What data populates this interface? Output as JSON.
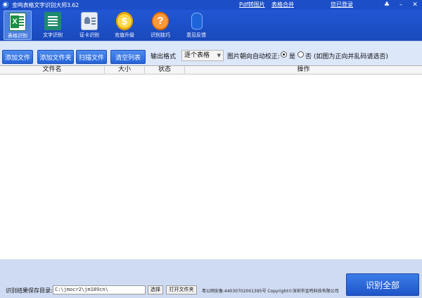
{
  "titlebar": {
    "title": "金鸣表格文字识别大师3.62",
    "links": {
      "pdf": "Pdf转图片",
      "merge": "表格合并",
      "login": "您已登录"
    },
    "window_buttons": {
      "skin": "♣",
      "minimize": "–",
      "close": "✕"
    }
  },
  "toolbar": {
    "tools": [
      {
        "label": "表格识别",
        "icon": "excel-icon",
        "active": true
      },
      {
        "label": "文字识别",
        "icon": "document-icon"
      },
      {
        "label": "证卡识别",
        "icon": "id-card-icon"
      },
      {
        "label": "充值升级",
        "icon": "coin-icon"
      },
      {
        "label": "识别技巧",
        "icon": "help-icon"
      },
      {
        "label": "意见反馈",
        "icon": "qq-penguin-icon"
      }
    ]
  },
  "options": {
    "buttons": {
      "add_file": "添加文件",
      "add_folder": "添加文件夹",
      "scan": "扫描文件",
      "clear": "清空列表"
    },
    "output_label": "输出格式",
    "output_value": "逐个表格",
    "orientation_label": "图片朝向自动校正:",
    "yes_label": "是",
    "no_label": "否 (如图为正向并乱码请选否)",
    "selected": "yes"
  },
  "table": {
    "columns": [
      "文件名",
      "大小",
      "状态",
      "操作"
    ],
    "rows": []
  },
  "footer": {
    "save_dir_label": "识别结果保存目录:",
    "save_dir_value": "C:\\jmocr2\\jm189cn\\",
    "choose_button": "选择",
    "open_folder_button": "打开文件夹",
    "copyright": "粤公网安备:44030702001395号 Copyright©深圳市金鸣科技有限公司",
    "recognize_all_button": "识别全部"
  }
}
